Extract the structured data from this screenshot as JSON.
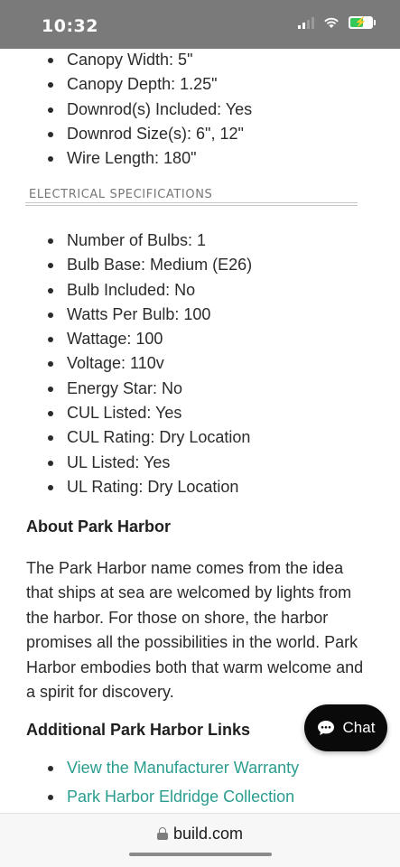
{
  "status_bar": {
    "time": "10:32",
    "signal_icon": "signal-bars-icon",
    "wifi_icon": "wifi-icon",
    "battery_icon": "battery-charging-icon"
  },
  "top_specs": [
    "Canopy Width: 5\"",
    "Canopy Depth: 1.25\"",
    "Downrod(s) Included: Yes",
    "Downrod Size(s): 6\", 12\"",
    "Wire Length: 180\""
  ],
  "electrical": {
    "heading": "ELECTRICAL SPECIFICATIONS",
    "items": [
      "Number of Bulbs: 1",
      "Bulb Base: Medium (E26)",
      "Bulb Included: No",
      "Watts Per Bulb: 100",
      "Wattage: 100",
      "Voltage: 110v",
      "Energy Star: No",
      "CUL Listed: Yes",
      "CUL Rating: Dry Location",
      "UL Listed: Yes",
      "UL Rating: Dry Location"
    ]
  },
  "about": {
    "title": "About Park Harbor",
    "text": "The Park Harbor name comes from the idea that ships at sea are welcomed by lights from the harbor. For those on shore, the harbor promises all the possibilities in the world. Park Harbor embodies both that warm welcome and a spirit for discovery."
  },
  "links": {
    "title": "Additional Park Harbor Links",
    "items": [
      "View the Manufacturer Warranty",
      "Park Harbor Eldridge Collection"
    ]
  },
  "chat": {
    "label": "Chat",
    "icon": "chat-bubble-icon"
  },
  "browser": {
    "url": "build.com",
    "lock_icon": "lock-icon"
  },
  "colors": {
    "status_bar_bg": "#7a7a7a",
    "link": "#2a9d8f",
    "chat_bg": "#0a0a0a"
  }
}
